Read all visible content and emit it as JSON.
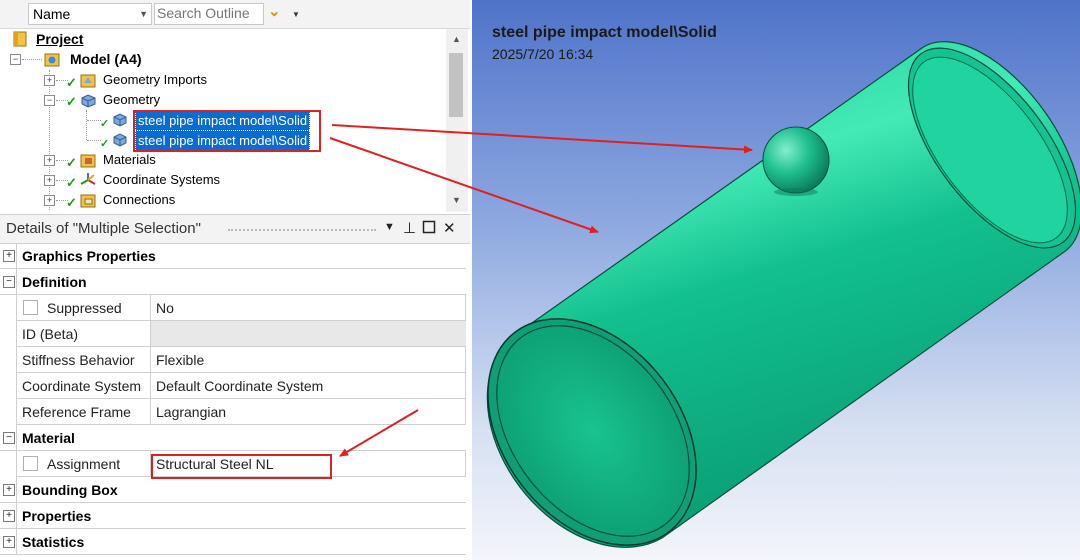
{
  "outline": {
    "column_name": "Name",
    "search_placeholder": "Search Outline",
    "tree": [
      {
        "label": "Project",
        "icon": "project-icon"
      },
      {
        "label": "Model (A4)",
        "icon": "model-icon"
      },
      {
        "label": "Geometry Imports",
        "icon": "geometry-imports-icon"
      },
      {
        "label": "Geometry",
        "icon": "geometry-icon"
      },
      {
        "label": "steel pipe impact model\\Solid",
        "icon": "solid-body-icon"
      },
      {
        "label": "steel pipe impact model\\Solid",
        "icon": "solid-body-icon"
      },
      {
        "label": "Materials",
        "icon": "materials-icon"
      },
      {
        "label": "Coordinate Systems",
        "icon": "coordinate-systems-icon"
      },
      {
        "label": "Connections",
        "icon": "connections-icon"
      }
    ]
  },
  "details": {
    "title": "Details of \"Multiple Selection\"",
    "groups": {
      "graphics": "Graphics Properties",
      "definition": "Definition",
      "material": "Material",
      "bounding_box": "Bounding Box",
      "properties": "Properties",
      "statistics": "Statistics"
    },
    "rows": {
      "suppressed": {
        "name": "Suppressed",
        "value": "No"
      },
      "id": {
        "name": "ID (Beta)",
        "value": ""
      },
      "stiffness": {
        "name": "Stiffness Behavior",
        "value": "Flexible"
      },
      "coord": {
        "name": "Coordinate System",
        "value": "Default Coordinate System"
      },
      "ref_frame": {
        "name": "Reference Frame",
        "value": "Lagrangian"
      },
      "assignment": {
        "name": "Assignment",
        "value": "Structural Steel NL"
      }
    }
  },
  "viewport": {
    "title": "steel pipe impact model\\Solid",
    "date": "2025/7/20 16:34"
  },
  "colors": {
    "selection": "#0a6cd1",
    "annotation": "#e02020",
    "pipe": "#10c890",
    "viewport_top": "#4f73c9"
  }
}
